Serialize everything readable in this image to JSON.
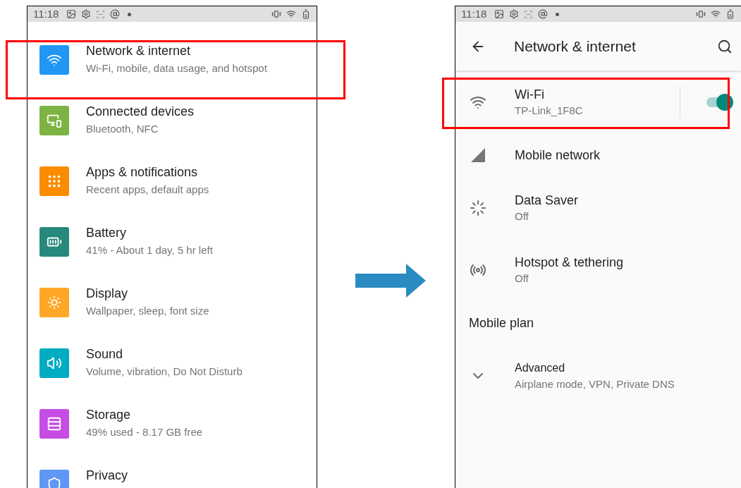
{
  "left_screen": {
    "status_bar": {
      "time": "11:18"
    },
    "items": [
      {
        "color": "#2196f3",
        "title": "Network & internet",
        "subtitle": "Wi-Fi, mobile, data usage, and hotspot",
        "highlighted": true
      },
      {
        "color": "#7cb342",
        "title": "Connected devices",
        "subtitle": "Bluetooth, NFC",
        "highlighted": false
      },
      {
        "color": "#fb8c00",
        "title": "Apps & notifications",
        "subtitle": "Recent apps, default apps",
        "highlighted": false
      },
      {
        "color": "#26897b",
        "title": "Battery",
        "subtitle": "41% - About 1 day, 5 hr left",
        "highlighted": false
      },
      {
        "color": "#ffa726",
        "title": "Display",
        "subtitle": "Wallpaper, sleep, font size",
        "highlighted": false
      },
      {
        "color": "#00acc1",
        "title": "Sound",
        "subtitle": "Volume, vibration, Do Not Disturb",
        "highlighted": false
      },
      {
        "color": "#c64de3",
        "title": "Storage",
        "subtitle": "49% used - 8.17 GB free",
        "highlighted": false
      },
      {
        "color": "#5e97f6",
        "title": "Privacy",
        "highlighted": false
      }
    ]
  },
  "right_screen": {
    "status_bar": {
      "time": "11:18"
    },
    "title": "Network & internet",
    "items": [
      {
        "kind": "setting",
        "title": "Wi-Fi",
        "subtitle": "TP-Link_1F8C",
        "switch": true,
        "highlighted": true
      },
      {
        "kind": "setting",
        "title": "Mobile network",
        "highlighted": false
      },
      {
        "kind": "setting",
        "title": "Data Saver",
        "subtitle": "Off",
        "highlighted": false
      },
      {
        "kind": "setting",
        "title": "Hotspot & tethering",
        "subtitle": "Off",
        "highlighted": false
      },
      {
        "kind": "heading",
        "title": "Mobile plan",
        "highlighted": false
      },
      {
        "kind": "expander",
        "title": "Advanced",
        "subtitle": "Airplane mode, VPN, Private DNS",
        "highlighted": false
      }
    ]
  }
}
